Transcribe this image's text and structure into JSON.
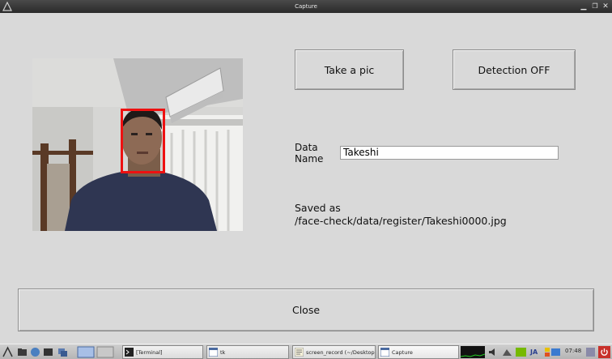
{
  "window": {
    "title": "Capture"
  },
  "buttons": {
    "take_pic": "Take a pic",
    "detection": "Detection OFF",
    "close": "Close"
  },
  "form": {
    "data_name_label_line1": "Data",
    "data_name_label_line2": "Name",
    "data_name_value": "Takeshi"
  },
  "status": {
    "line1": "Saved as",
    "line2": "/face-check/data/register/Takeshi0000.jpg"
  },
  "taskbar": {
    "tasks": [
      "[Terminal]",
      "tk",
      "screen_record (~/Desktop)",
      "Capture"
    ],
    "clock": "07:48",
    "keyboard_layout": "JA"
  },
  "colors": {
    "window_bg": "#d9d9d9",
    "face_box": "#ee1111"
  }
}
